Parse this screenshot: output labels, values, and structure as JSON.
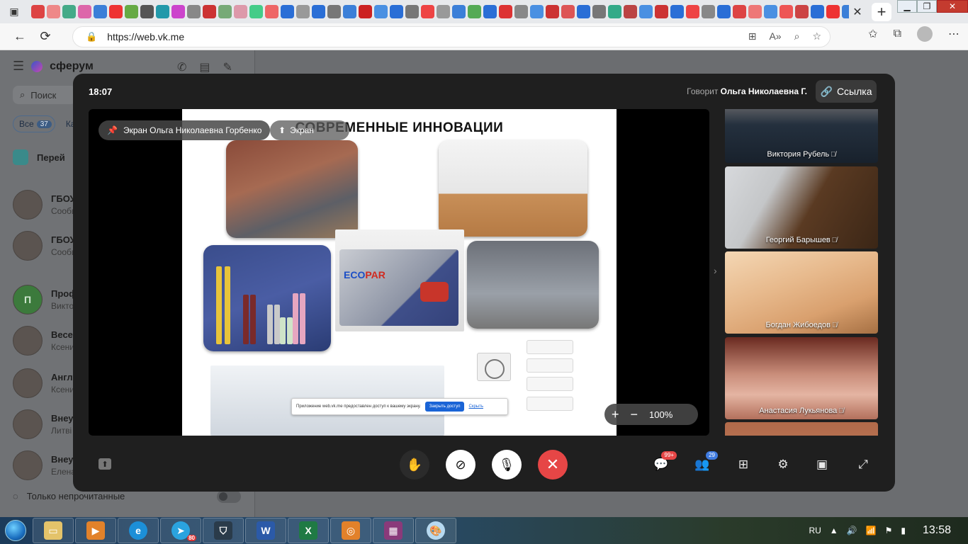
{
  "browser": {
    "url": "https://web.vk.me",
    "tab_close": "✕",
    "new_tab": "+"
  },
  "vk": {
    "brand": "сферум",
    "search_placeholder": "Поиск",
    "filter_all": "Все",
    "filter_all_count": "37",
    "filter_next": "Ка",
    "pinned_label": "Перей",
    "chats": [
      {
        "name": "ГБОУ",
        "sub": "Сообщ"
      },
      {
        "name": "ГБОУ",
        "sub": "Сообщ"
      },
      {
        "name": "Проф",
        "sub": "Викто",
        "initial": "П"
      },
      {
        "name": "Весе",
        "sub": "Ксени"
      },
      {
        "name": "Англ",
        "sub": "Ксени"
      },
      {
        "name": "Внеу",
        "sub": "Литвi"
      },
      {
        "name": "Внеу",
        "sub": "Елена"
      }
    ],
    "only_unread": "Только непрочитанные"
  },
  "call": {
    "time": "18:07",
    "speaking_prefix": "Говорит",
    "speaking_name": "Ольга Николаевна Г.",
    "link_label": "Ссылка",
    "screen_label": "Экран Ольга Николаевна Горбенко",
    "screen_label2": "Экран",
    "zoom": "100%",
    "zoom_in": "+",
    "zoom_out": "−",
    "slide": {
      "title": "СОВРЕМЕННЫЕ ИННОВАЦИИ",
      "brand_eco": "ECO",
      "brand_par": "PAR",
      "notice_text": "Приложение web.vk.me предоставлен доступ к вашему экрану.",
      "notice_stop": "Закрыть доступ",
      "notice_hide": "Скрыть"
    },
    "participants": [
      {
        "name": "Виктория Рубель"
      },
      {
        "name": "Георгий Барышев"
      },
      {
        "name": "Богдан Жибоедов"
      },
      {
        "name": "Анастасия Лукьянова"
      }
    ],
    "chat_badge": "99+",
    "people_badge": "29"
  },
  "taskbar": {
    "lang": "RU",
    "clock": "13:58",
    "word_label": "W",
    "excel_label": "X",
    "telegram_badge": "80"
  },
  "icons": {
    "tab_menu": "tab-actions-icon",
    "back": "back-arrow-icon",
    "reload": "reload-icon",
    "lock": "lock-icon",
    "hand": "raise-hand-icon",
    "camera_off": "camera-off-icon",
    "mic_off": "mic-off-icon",
    "hang_up": "hang-up-icon",
    "chat": "chat-icon",
    "people": "participants-icon",
    "grid": "grid-view-icon",
    "settings": "gear-icon",
    "layout": "layout-icon",
    "fullscreen": "fullscreen-icon"
  },
  "colors": {
    "hang_up": "#e64646",
    "accent_blue": "#3f7be0",
    "call_bg": "#1f1f1f"
  }
}
